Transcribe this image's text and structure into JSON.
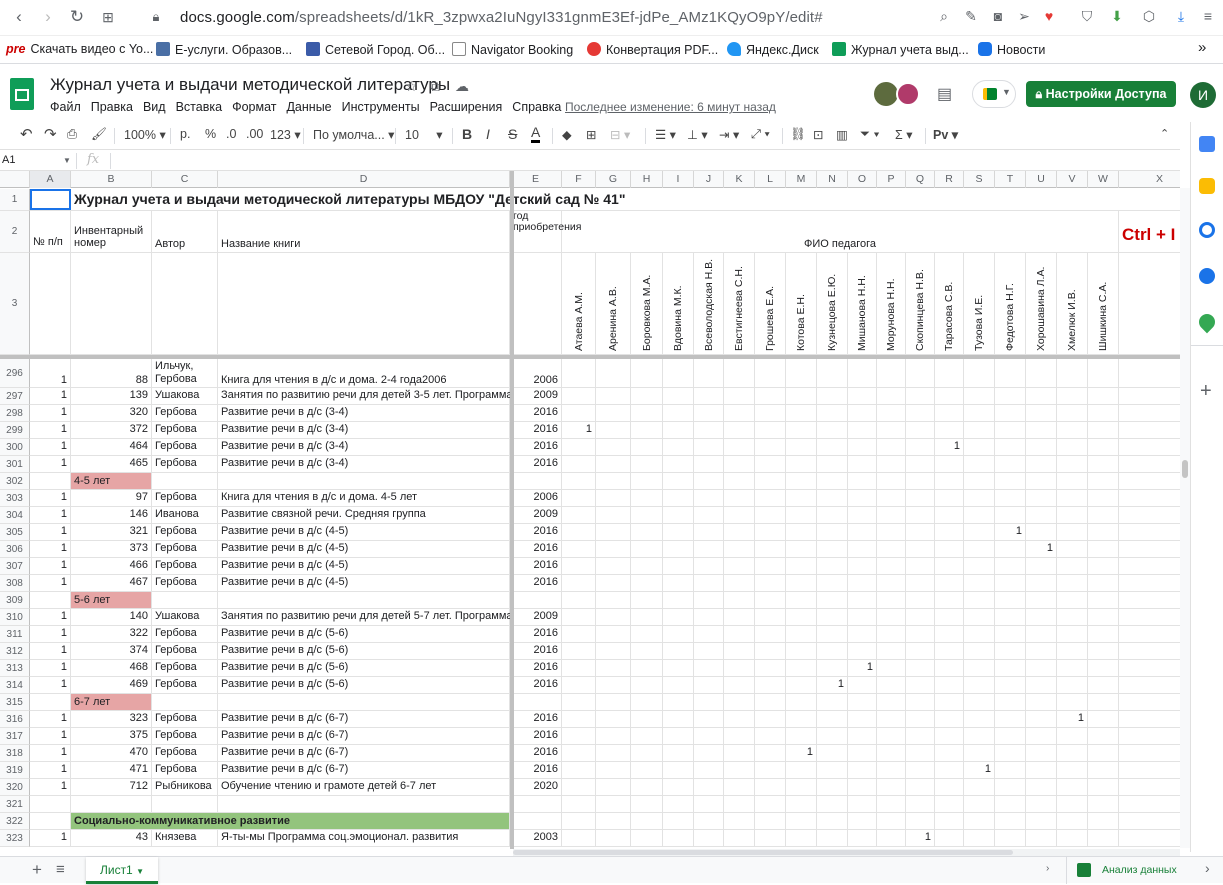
{
  "browser": {
    "url_host": "docs.google.com",
    "url_path": "/spreadsheets/d/1kR_3zpwxa2IuNgyI331gnmE3Ef-jdPe_AMz1KQyO9pY/edit#",
    "bookmarks": [
      {
        "label": "Скачать видео с Yo...",
        "prefix": "pre",
        "color": "#cc0000"
      },
      {
        "label": "Е-услуги. Образов...",
        "color": "#4a6fa5"
      },
      {
        "label": "Сетевой Город. Об...",
        "color": "#3b5ba8"
      },
      {
        "label": "Navigator Booking",
        "color": "#888"
      },
      {
        "label": "Конвертация PDF...",
        "color": "#e53935"
      },
      {
        "label": "Яндекс.Диск",
        "color": "#2196f3"
      },
      {
        "label": "Журнал учета выд...",
        "color": "#0f9d58"
      },
      {
        "label": "Новости",
        "color": "#1a73e8"
      }
    ],
    "more": "»"
  },
  "doc": {
    "title": "Журнал учета и выдачи методической литературы",
    "menu": [
      "Файл",
      "Правка",
      "Вид",
      "Вставка",
      "Формат",
      "Данные",
      "Инструменты",
      "Расширения",
      "Справка"
    ],
    "last_edit": "Последнее изменение: 6 минут назад",
    "share_label": "Настройки Доступа",
    "user_initial": "И"
  },
  "toolbar": {
    "zoom": "100%",
    "currency": "р.",
    "percent": "%",
    "dec_less": ".0",
    "dec_more": ".00",
    "format_123": "123",
    "font": "По умолча...",
    "font_size": "10",
    "bold": "B",
    "italic": "I",
    "strike": "S",
    "text_color": "A",
    "input_tools": "Рv"
  },
  "formula_bar": {
    "cell_ref": "A1",
    "fx": "fx"
  },
  "columns": [
    "A",
    "B",
    "C",
    "D",
    "E",
    "F",
    "G",
    "H",
    "I",
    "J",
    "K",
    "L",
    "M",
    "N",
    "O",
    "P",
    "Q",
    "R",
    "S",
    "T",
    "U",
    "V",
    "W",
    "X"
  ],
  "header": {
    "title": "Журнал учета и выдачи методической литературы МБДОУ \"Детский сад № 41\"",
    "col_a": "№ п/п",
    "col_b": "Инвентарный номер",
    "col_c": "Автор",
    "col_d": "Название книги",
    "col_e": "год приобретения",
    "fio": "ФИО педагога",
    "ctrl": "Ctrl + I",
    "teachers": [
      "Атаева А.М.",
      "Аренина А.В.",
      "Боровкова М.А.",
      "Вдовина М.К.",
      "Всеволодская Н.В.",
      "Евстигнеева С.Н.",
      "Грошева Е.А.",
      "Котова Е.Н.",
      "Кузнецова Е.Ю.",
      "Мишанова Н.Н.",
      "Морунова Н.Н.",
      "Скопинцева Н.В.",
      "Тарасова С.В.",
      "Тузова И.Е.",
      "Федотова Н.Г.",
      "Хорошавина Л.А.",
      "Хмелюк И.В.",
      "Шишкина С.А."
    ]
  },
  "rows": [
    {
      "n": "296",
      "a": "1",
      "b": "88",
      "c": "Ильчук, Гербова",
      "d": "Книга для чтения в д/с и дома. 2-4 года2006",
      "e": "2006",
      "mark": null
    },
    {
      "n": "297",
      "a": "1",
      "b": "139",
      "c": "Ушакова",
      "d": "Занятия по развитию речи для детей 3-5 лет. Программа",
      "e": "2009",
      "mark": null
    },
    {
      "n": "298",
      "a": "1",
      "b": "320",
      "c": "Гербова",
      "d": "Развитие речи в д/с (3-4)",
      "e": "2016",
      "mark": null
    },
    {
      "n": "299",
      "a": "1",
      "b": "372",
      "c": "Гербова",
      "d": "Развитие речи в д/с (3-4)",
      "e": "2016",
      "mark": 1
    },
    {
      "n": "300",
      "a": "1",
      "b": "464",
      "c": "Гербова",
      "d": "Развитие речи в д/с (3-4)",
      "e": "2016",
      "mark": 13
    },
    {
      "n": "301",
      "a": "1",
      "b": "465",
      "c": "Гербова",
      "d": "Развитие речи в д/с (3-4)",
      "e": "2016",
      "mark": null
    },
    {
      "n": "302",
      "section": "4-5 лет",
      "color": "#e6a5a5"
    },
    {
      "n": "303",
      "a": "1",
      "b": "97",
      "c": "Гербова",
      "d": "Книга для чтения в д/с и дома. 4-5 лет",
      "e": "2006",
      "mark": null
    },
    {
      "n": "304",
      "a": "1",
      "b": "146",
      "c": "Иванова",
      "d": "Развитие связной речи. Средняя группа",
      "e": "2009",
      "mark": null
    },
    {
      "n": "305",
      "a": "1",
      "b": "321",
      "c": "Гербова",
      "d": "Развитие речи в д/с (4-5)",
      "e": "2016",
      "mark": 15
    },
    {
      "n": "306",
      "a": "1",
      "b": "373",
      "c": "Гербова",
      "d": "Развитие речи в д/с (4-5)",
      "e": "2016",
      "mark": 16
    },
    {
      "n": "307",
      "a": "1",
      "b": "466",
      "c": "Гербова",
      "d": "Развитие речи в д/с (4-5)",
      "e": "2016",
      "mark": null
    },
    {
      "n": "308",
      "a": "1",
      "b": "467",
      "c": "Гербова",
      "d": "Развитие речи в д/с (4-5)",
      "e": "2016",
      "mark": null
    },
    {
      "n": "309",
      "section": "5-6 лет",
      "color": "#e6a5a5"
    },
    {
      "n": "310",
      "a": "1",
      "b": "140",
      "c": "Ушакова",
      "d": "Занятия по развитию речи для детей 5-7 лет. Программа",
      "e": "2009",
      "mark": null
    },
    {
      "n": "311",
      "a": "1",
      "b": "322",
      "c": "Гербова",
      "d": "Развитие речи в д/с (5-6)",
      "e": "2016",
      "mark": null
    },
    {
      "n": "312",
      "a": "1",
      "b": "374",
      "c": "Гербова",
      "d": "Развитие речи в д/с (5-6)",
      "e": "2016",
      "mark": null
    },
    {
      "n": "313",
      "a": "1",
      "b": "468",
      "c": "Гербова",
      "d": "Развитие речи в д/с (5-6)",
      "e": "2016",
      "mark": 10
    },
    {
      "n": "314",
      "a": "1",
      "b": "469",
      "c": "Гербова",
      "d": "Развитие речи в д/с (5-6)",
      "e": "2016",
      "mark": 9
    },
    {
      "n": "315",
      "section": "6-7 лет",
      "color": "#e6a5a5"
    },
    {
      "n": "316",
      "a": "1",
      "b": "323",
      "c": "Гербова",
      "d": "Развитие речи в д/с (6-7)",
      "e": "2016",
      "mark": 17
    },
    {
      "n": "317",
      "a": "1",
      "b": "375",
      "c": "Гербова",
      "d": "Развитие речи в д/с (6-7)",
      "e": "2016",
      "mark": null
    },
    {
      "n": "318",
      "a": "1",
      "b": "470",
      "c": "Гербова",
      "d": "Развитие речи в д/с (6-7)",
      "e": "2016",
      "mark": 8
    },
    {
      "n": "319",
      "a": "1",
      "b": "471",
      "c": "Гербова",
      "d": "Развитие речи в д/с (6-7)",
      "e": "2016",
      "mark": 14
    },
    {
      "n": "320",
      "a": "1",
      "b": "712",
      "c": "Рыбникова",
      "d": "Обучение чтению и грамоте детей 6-7 лет",
      "e": "2020",
      "mark": null
    },
    {
      "n": "321",
      "empty": true
    },
    {
      "n": "322",
      "bigsection": "Социально-коммуникативное развитие",
      "color": "#93c47d"
    },
    {
      "n": "323",
      "a": "1",
      "b": "43",
      "c": "Князева",
      "d": "Я-ты-мы Программа соц.эмоционал. развития",
      "e": "2003",
      "mark": 12
    }
  ],
  "mark_value": "1",
  "sheet_tab": "Лист1",
  "explore_label": "Анализ данных"
}
